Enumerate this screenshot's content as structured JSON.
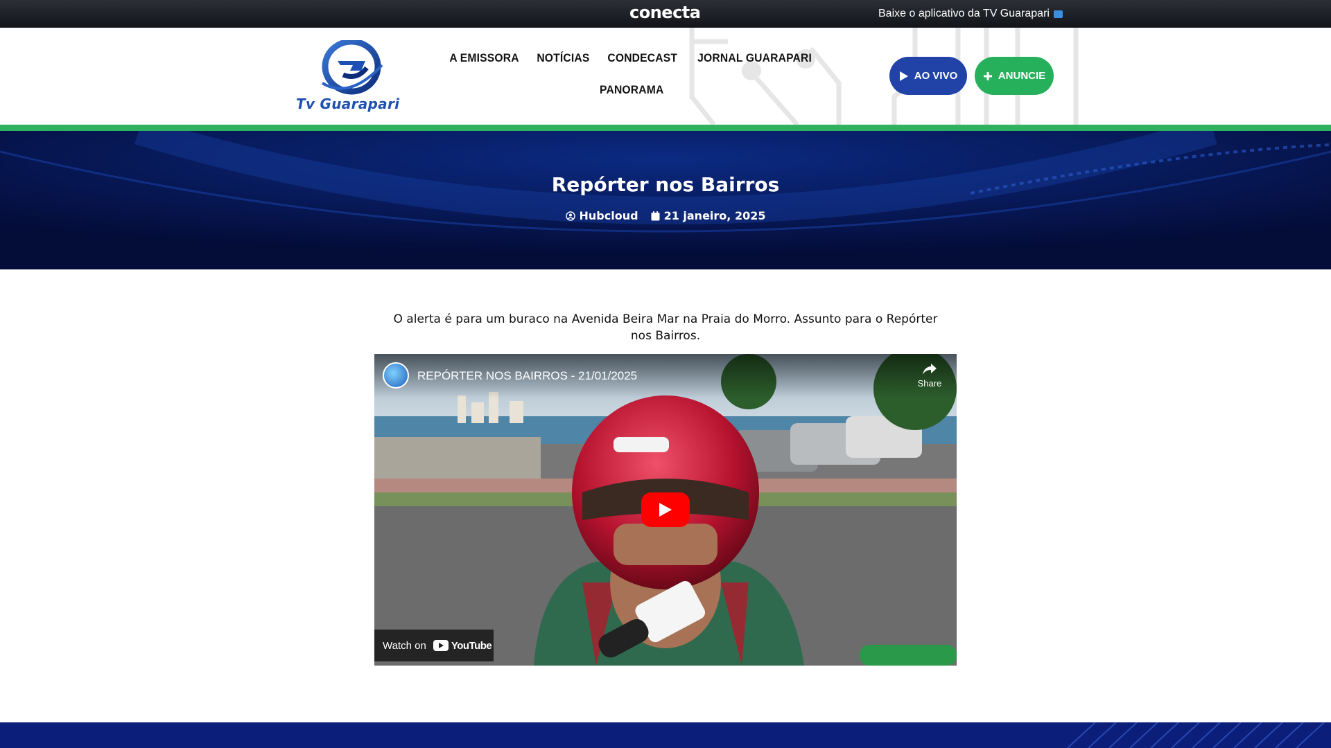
{
  "topbar": {
    "brand": "conecta",
    "app_link": "Baixe o aplicativo da TV Guarapari"
  },
  "header": {
    "logo_text": "Tv Guarapari",
    "nav": [
      {
        "label": "A EMISSORA"
      },
      {
        "label": "NOTÍCIAS"
      },
      {
        "label": "CONDECAST"
      },
      {
        "label": "JORNAL GUARAPARI"
      },
      {
        "label": "PANORAMA"
      }
    ],
    "live_button": "AO VIVO",
    "ads_button": "ANUNCIE"
  },
  "hero": {
    "title": "Repórter nos Bairros",
    "author": "Hubcloud",
    "date": "21 janeiro, 2025"
  },
  "article": {
    "text": "O alerta é para um buraco na Avenida Beira Mar na Praia do Morro. Assunto para o Repórter nos Bairros."
  },
  "video": {
    "title": "REPÓRTER NOS BAIRROS - 21/01/2025",
    "share_label": "Share",
    "watch_on_label": "Watch on",
    "youtube_label": "YouTube"
  },
  "colors": {
    "primary_blue": "#2143a8",
    "green": "#27b05c",
    "hero_bg": "#05114a"
  }
}
